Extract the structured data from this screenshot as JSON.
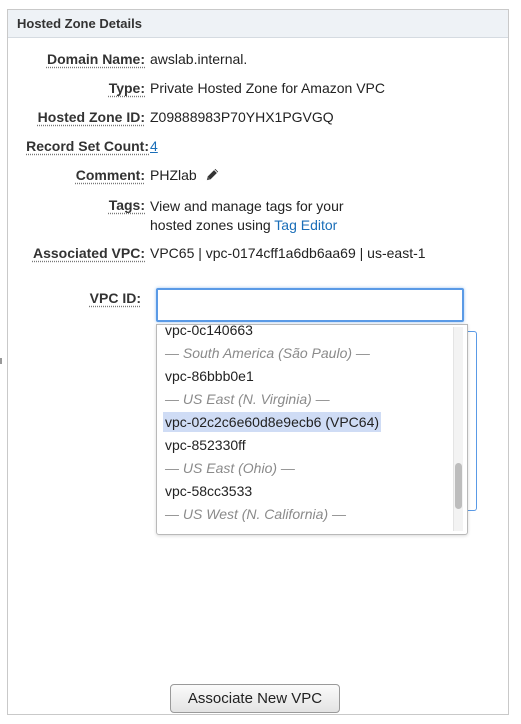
{
  "panel": {
    "title": "Hosted Zone Details"
  },
  "details": {
    "domain_name_label": "Domain Name:",
    "domain_name": "awslab.internal.",
    "type_label": "Type:",
    "type": "Private Hosted Zone for Amazon VPC",
    "hosted_zone_id_label": "Hosted Zone ID:",
    "hosted_zone_id": "Z09888983P70YHX1PGVGQ",
    "record_set_count_label": "Record Set Count:",
    "record_set_count": "4",
    "comment_label": "Comment:",
    "comment": "PHZlab",
    "tags_label": "Tags:",
    "tags_line1": "View and manage tags for your",
    "tags_line2_prefix": "hosted zones using",
    "tags_link": "Tag Editor",
    "associated_vpc_label": "Associated VPC:",
    "associated_vpc": "VPC65 | vpc-0174cff1a6db6aa69 | us-east-1",
    "vpc_id_label": "VPC ID:"
  },
  "vpc_input": {
    "value": "",
    "placeholder": ""
  },
  "dropdown": {
    "items": [
      {
        "text": "vpc-0c140663",
        "kind": "option"
      },
      {
        "text": "— South America (São Paulo) —",
        "kind": "group"
      },
      {
        "text": "vpc-86bbb0e1",
        "kind": "option"
      },
      {
        "text": "— US East (N. Virginia) —",
        "kind": "group"
      },
      {
        "text": "vpc-02c2c6e60d8e9ecb6 (VPC64)",
        "kind": "option",
        "selected": true
      },
      {
        "text": "vpc-852330ff",
        "kind": "option"
      },
      {
        "text": "— US East (Ohio) —",
        "kind": "group"
      },
      {
        "text": "vpc-58cc3533",
        "kind": "option"
      },
      {
        "text": "— US West (N. California) —",
        "kind": "group"
      }
    ]
  },
  "buttons": {
    "associate_new_vpc": "Associate New VPC"
  },
  "icons": {
    "comment_edit": "pencil-icon"
  },
  "colors": {
    "link": "#1a6eb8",
    "selection": "#cfdcf5",
    "focus": "#5a9ae6"
  }
}
